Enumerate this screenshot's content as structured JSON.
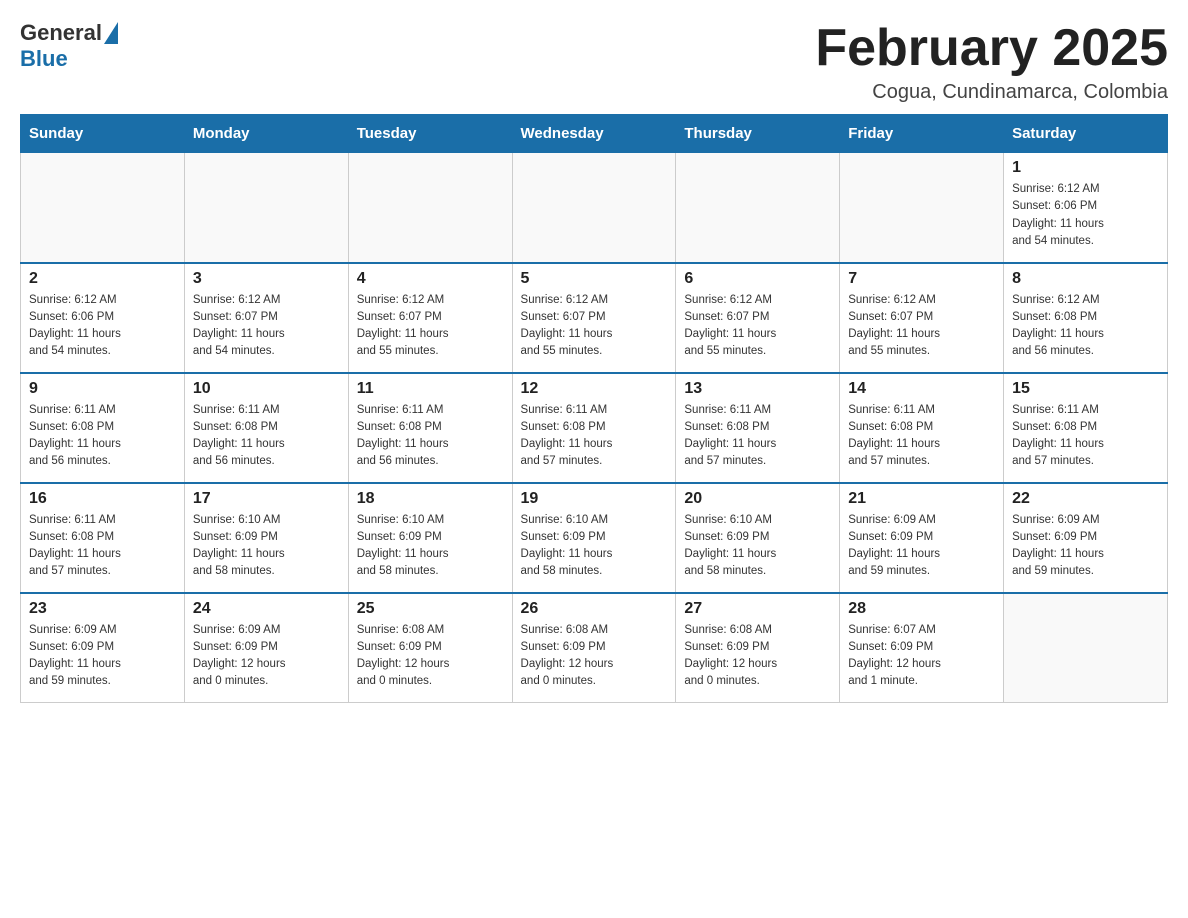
{
  "header": {
    "logo_general": "General",
    "logo_blue": "Blue",
    "month_title": "February 2025",
    "location": "Cogua, Cundinamarca, Colombia"
  },
  "days_of_week": [
    "Sunday",
    "Monday",
    "Tuesday",
    "Wednesday",
    "Thursday",
    "Friday",
    "Saturday"
  ],
  "weeks": [
    [
      {
        "day": "",
        "info": ""
      },
      {
        "day": "",
        "info": ""
      },
      {
        "day": "",
        "info": ""
      },
      {
        "day": "",
        "info": ""
      },
      {
        "day": "",
        "info": ""
      },
      {
        "day": "",
        "info": ""
      },
      {
        "day": "1",
        "info": "Sunrise: 6:12 AM\nSunset: 6:06 PM\nDaylight: 11 hours\nand 54 minutes."
      }
    ],
    [
      {
        "day": "2",
        "info": "Sunrise: 6:12 AM\nSunset: 6:06 PM\nDaylight: 11 hours\nand 54 minutes."
      },
      {
        "day": "3",
        "info": "Sunrise: 6:12 AM\nSunset: 6:07 PM\nDaylight: 11 hours\nand 54 minutes."
      },
      {
        "day": "4",
        "info": "Sunrise: 6:12 AM\nSunset: 6:07 PM\nDaylight: 11 hours\nand 55 minutes."
      },
      {
        "day": "5",
        "info": "Sunrise: 6:12 AM\nSunset: 6:07 PM\nDaylight: 11 hours\nand 55 minutes."
      },
      {
        "day": "6",
        "info": "Sunrise: 6:12 AM\nSunset: 6:07 PM\nDaylight: 11 hours\nand 55 minutes."
      },
      {
        "day": "7",
        "info": "Sunrise: 6:12 AM\nSunset: 6:07 PM\nDaylight: 11 hours\nand 55 minutes."
      },
      {
        "day": "8",
        "info": "Sunrise: 6:12 AM\nSunset: 6:08 PM\nDaylight: 11 hours\nand 56 minutes."
      }
    ],
    [
      {
        "day": "9",
        "info": "Sunrise: 6:11 AM\nSunset: 6:08 PM\nDaylight: 11 hours\nand 56 minutes."
      },
      {
        "day": "10",
        "info": "Sunrise: 6:11 AM\nSunset: 6:08 PM\nDaylight: 11 hours\nand 56 minutes."
      },
      {
        "day": "11",
        "info": "Sunrise: 6:11 AM\nSunset: 6:08 PM\nDaylight: 11 hours\nand 56 minutes."
      },
      {
        "day": "12",
        "info": "Sunrise: 6:11 AM\nSunset: 6:08 PM\nDaylight: 11 hours\nand 57 minutes."
      },
      {
        "day": "13",
        "info": "Sunrise: 6:11 AM\nSunset: 6:08 PM\nDaylight: 11 hours\nand 57 minutes."
      },
      {
        "day": "14",
        "info": "Sunrise: 6:11 AM\nSunset: 6:08 PM\nDaylight: 11 hours\nand 57 minutes."
      },
      {
        "day": "15",
        "info": "Sunrise: 6:11 AM\nSunset: 6:08 PM\nDaylight: 11 hours\nand 57 minutes."
      }
    ],
    [
      {
        "day": "16",
        "info": "Sunrise: 6:11 AM\nSunset: 6:08 PM\nDaylight: 11 hours\nand 57 minutes."
      },
      {
        "day": "17",
        "info": "Sunrise: 6:10 AM\nSunset: 6:09 PM\nDaylight: 11 hours\nand 58 minutes."
      },
      {
        "day": "18",
        "info": "Sunrise: 6:10 AM\nSunset: 6:09 PM\nDaylight: 11 hours\nand 58 minutes."
      },
      {
        "day": "19",
        "info": "Sunrise: 6:10 AM\nSunset: 6:09 PM\nDaylight: 11 hours\nand 58 minutes."
      },
      {
        "day": "20",
        "info": "Sunrise: 6:10 AM\nSunset: 6:09 PM\nDaylight: 11 hours\nand 58 minutes."
      },
      {
        "day": "21",
        "info": "Sunrise: 6:09 AM\nSunset: 6:09 PM\nDaylight: 11 hours\nand 59 minutes."
      },
      {
        "day": "22",
        "info": "Sunrise: 6:09 AM\nSunset: 6:09 PM\nDaylight: 11 hours\nand 59 minutes."
      }
    ],
    [
      {
        "day": "23",
        "info": "Sunrise: 6:09 AM\nSunset: 6:09 PM\nDaylight: 11 hours\nand 59 minutes."
      },
      {
        "day": "24",
        "info": "Sunrise: 6:09 AM\nSunset: 6:09 PM\nDaylight: 12 hours\nand 0 minutes."
      },
      {
        "day": "25",
        "info": "Sunrise: 6:08 AM\nSunset: 6:09 PM\nDaylight: 12 hours\nand 0 minutes."
      },
      {
        "day": "26",
        "info": "Sunrise: 6:08 AM\nSunset: 6:09 PM\nDaylight: 12 hours\nand 0 minutes."
      },
      {
        "day": "27",
        "info": "Sunrise: 6:08 AM\nSunset: 6:09 PM\nDaylight: 12 hours\nand 0 minutes."
      },
      {
        "day": "28",
        "info": "Sunrise: 6:07 AM\nSunset: 6:09 PM\nDaylight: 12 hours\nand 1 minute."
      },
      {
        "day": "",
        "info": ""
      }
    ]
  ]
}
